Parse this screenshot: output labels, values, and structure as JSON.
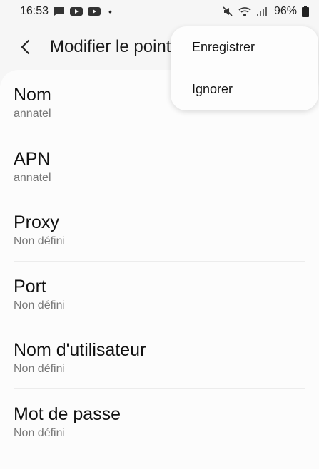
{
  "status_bar": {
    "time": "16:53",
    "battery_percent": "96%",
    "left_icons": [
      "message-icon",
      "youtube-icon",
      "youtube-icon"
    ],
    "right_icons": [
      "mute-icon",
      "wifi-icon",
      "signal-icon",
      "battery-icon"
    ]
  },
  "header": {
    "back_icon": "back-arrow-icon",
    "title": "Modifier le point d'accès"
  },
  "menu": {
    "items": [
      {
        "label": "Enregistrer"
      },
      {
        "label": "Ignorer"
      }
    ]
  },
  "fields": [
    {
      "title": "Nom",
      "value": "annatel"
    },
    {
      "title": "APN",
      "value": "annatel"
    },
    {
      "title": "Proxy",
      "value": "Non défini"
    },
    {
      "title": "Port",
      "value": "Non défini"
    },
    {
      "title": "Nom d'utilisateur",
      "value": "Non défini"
    },
    {
      "title": "Mot de passe",
      "value": "Non défini"
    }
  ]
}
